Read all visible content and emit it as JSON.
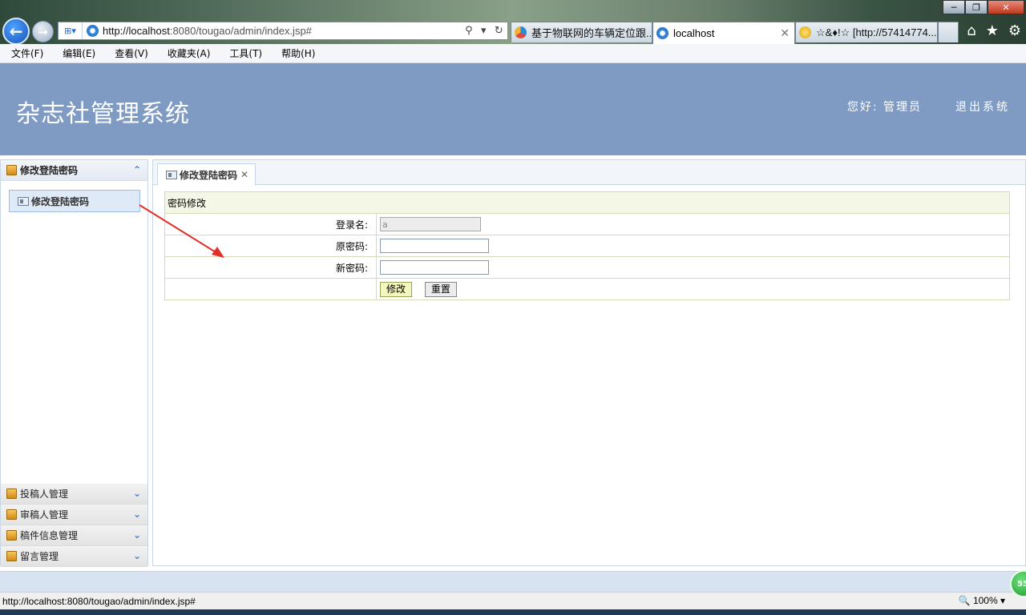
{
  "browser": {
    "address": "http://localhost:8080/tougao/admin/index.jsp#",
    "address_host": "http://localhost",
    "address_rest": ":8080/tougao/admin/index.jsp#",
    "tabs": [
      {
        "label": "基于物联网的车辆定位跟..."
      },
      {
        "label": "localhost"
      },
      {
        "label": "☆&♦!☆ [http://57414774..."
      }
    ],
    "menu": [
      "文件(F)",
      "编辑(E)",
      "查看(V)",
      "收藏夹(A)",
      "工具(T)",
      "帮助(H)"
    ],
    "status_url": "http://localhost:8080/tougao/admin/index.jsp#",
    "zoom": "100%",
    "badge": "55"
  },
  "header": {
    "title": "杂志社管理系统",
    "welcome": "您好: 管理员",
    "logout": "退出系统"
  },
  "sidebar": {
    "open_section": "修改登陆密码",
    "open_link": "修改登陆密码",
    "sections": [
      "投稿人管理",
      "审稿人管理",
      "稿件信息管理",
      "留言管理"
    ]
  },
  "main": {
    "tab_label": "修改登陆密码",
    "form_title": "密码修改",
    "login_label": "登录名:",
    "login_value": "a",
    "old_pwd_label": "原密码:",
    "new_pwd_label": "新密码:",
    "submit_label": "修改",
    "reset_label": "重置"
  }
}
